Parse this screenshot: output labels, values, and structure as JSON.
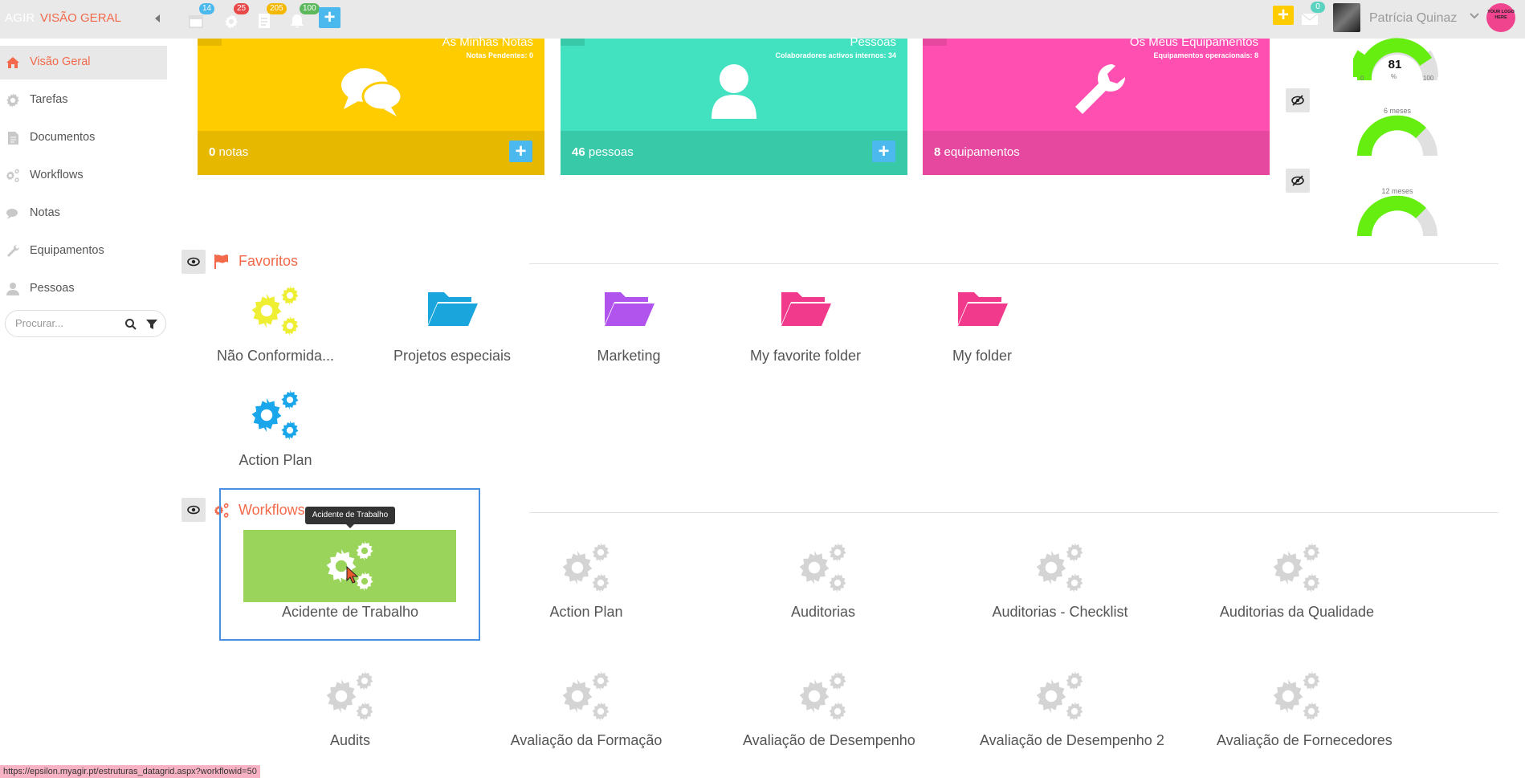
{
  "app": {
    "brand": "AGIR",
    "breadcrumb": "VISÃO GERAL"
  },
  "topbar": {
    "calendar_badge": "14",
    "tasks_badge": "25",
    "docs_badge": "205",
    "alerts_badge": "100",
    "add_label": "+",
    "mail_badge": "0",
    "user_name": "Patrícia Quinaz",
    "logo_text": "YOUR LOGO HERE"
  },
  "sidebar": {
    "items": [
      {
        "label": "Visão Geral",
        "icon": "home-icon"
      },
      {
        "label": "Tarefas",
        "icon": "gear-icon"
      },
      {
        "label": "Documentos",
        "icon": "document-icon"
      },
      {
        "label": "Workflows",
        "icon": "gears-icon"
      },
      {
        "label": "Notas",
        "icon": "chat-icon"
      },
      {
        "label": "Equipamentos",
        "icon": "wrench-icon"
      },
      {
        "label": "Pessoas",
        "icon": "user-icon"
      }
    ],
    "search_placeholder": "Procurar..."
  },
  "cards": [
    {
      "title": "As Minhas Notas",
      "subtitle": "Notas Pendentes: 0",
      "count": "0",
      "unit": " notas",
      "color": "#ffcc00",
      "bottom_color": "#e6b800",
      "icon": "chat-bubbles-icon"
    },
    {
      "title": "Pessoas",
      "subtitle": "Colaboradores activos internos: 34",
      "count": "46",
      "unit": " pessoas",
      "color": "#42e2c0",
      "bottom_color": "#38c9a9",
      "icon": "person-icon"
    },
    {
      "title": "Os Meus Equipamentos",
      "subtitle": "Equipamentos operacionais: 8",
      "count": "8",
      "unit": " equipamentos",
      "color": "#ff4fb1",
      "bottom_color": "#e6479f",
      "icon": "wrench-icon"
    }
  ],
  "gauges": {
    "main_value": "81",
    "pct": "%",
    "min": "0",
    "max": "100",
    "label_6": "6 meses",
    "label_12": "12 meses",
    "fill_main": 0.81,
    "fill_6": 0.75,
    "fill_12": 0.75,
    "fill_color": "#66ee11"
  },
  "favoritos": {
    "title": "Favoritos",
    "items": [
      {
        "label": "Não Conformida...",
        "type": "gears",
        "color": "#eeee33"
      },
      {
        "label": "Projetos especiais",
        "type": "folder",
        "color": "#1aa6dc"
      },
      {
        "label": "Marketing",
        "type": "folder",
        "color": "#b154ee"
      },
      {
        "label": "My favorite folder",
        "type": "folder",
        "color": "#f23a8c"
      },
      {
        "label": "My folder",
        "type": "folder",
        "color": "#f23a8c"
      },
      {
        "label": "Action Plan",
        "type": "gears",
        "color": "#1aa6ea"
      }
    ]
  },
  "workflows": {
    "title": "Workflows",
    "tooltip": "Acidente de Trabalho",
    "items": [
      {
        "label": "Acidente de Trabalho"
      },
      {
        "label": "Action Plan"
      },
      {
        "label": "Auditorias"
      },
      {
        "label": "Auditorias - Checklist"
      },
      {
        "label": "Auditorias da Qualidade"
      },
      {
        "label": "Audits"
      },
      {
        "label": "Avaliação da Formação"
      },
      {
        "label": "Avaliação de Desempenho"
      },
      {
        "label": "Avaliação de Desempenho 2"
      },
      {
        "label": "Avaliação de Fornecedores"
      }
    ]
  },
  "status_bar": {
    "url": "https://epsilon.myagir.pt/estruturas_datagrid.aspx?workflowid=50"
  }
}
